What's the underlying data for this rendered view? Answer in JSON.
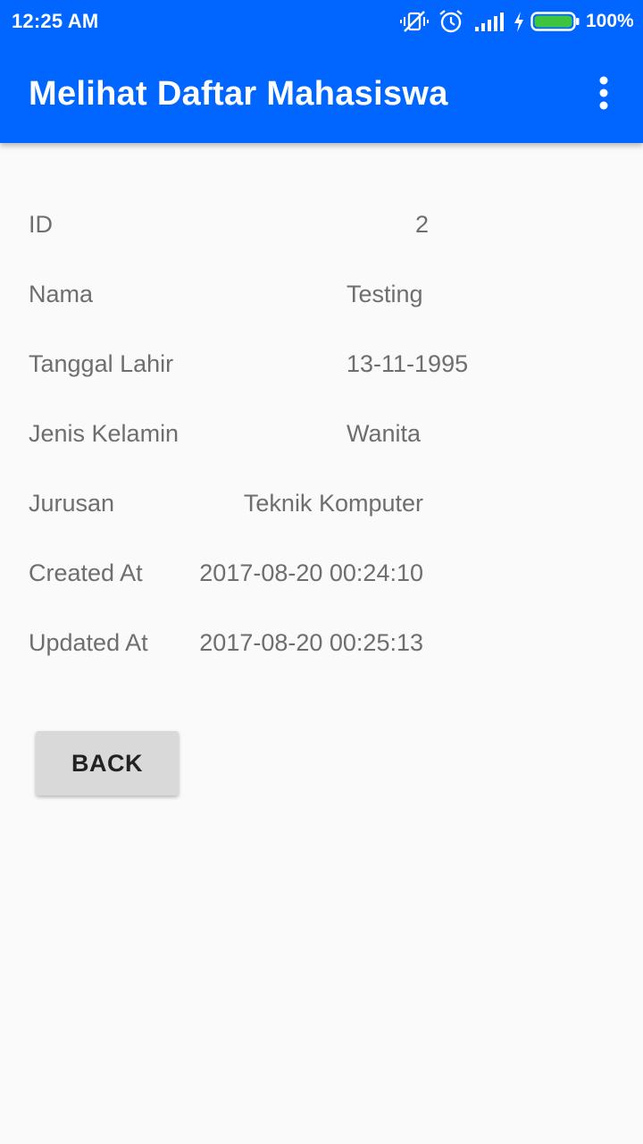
{
  "status_bar": {
    "time": "12:25 AM",
    "battery_percent": "100%",
    "icons": [
      "vibrate-icon",
      "alarm-icon",
      "signal-icon",
      "charging-icon",
      "battery-icon"
    ]
  },
  "toolbar": {
    "title": "Melihat Daftar Mahasiswa",
    "menu_icon": "more-vert-icon"
  },
  "details": [
    {
      "label": "ID",
      "value": "2"
    },
    {
      "label": "Nama",
      "value": "Testing"
    },
    {
      "label": "Tanggal Lahir",
      "value": "13-11-1995"
    },
    {
      "label": "Jenis Kelamin",
      "value": "Wanita"
    },
    {
      "label": "Jurusan",
      "value": "Teknik Komputer"
    },
    {
      "label": "Created At",
      "value": "2017-08-20 00:24:10"
    },
    {
      "label": "Updated At",
      "value": "2017-08-20 00:25:13"
    }
  ],
  "back_button": {
    "label": "BACK"
  },
  "colors": {
    "app_bar": "#0066ff",
    "background": "#fafafa",
    "text": "#6e6e6e",
    "button": "#d9d9d9"
  }
}
